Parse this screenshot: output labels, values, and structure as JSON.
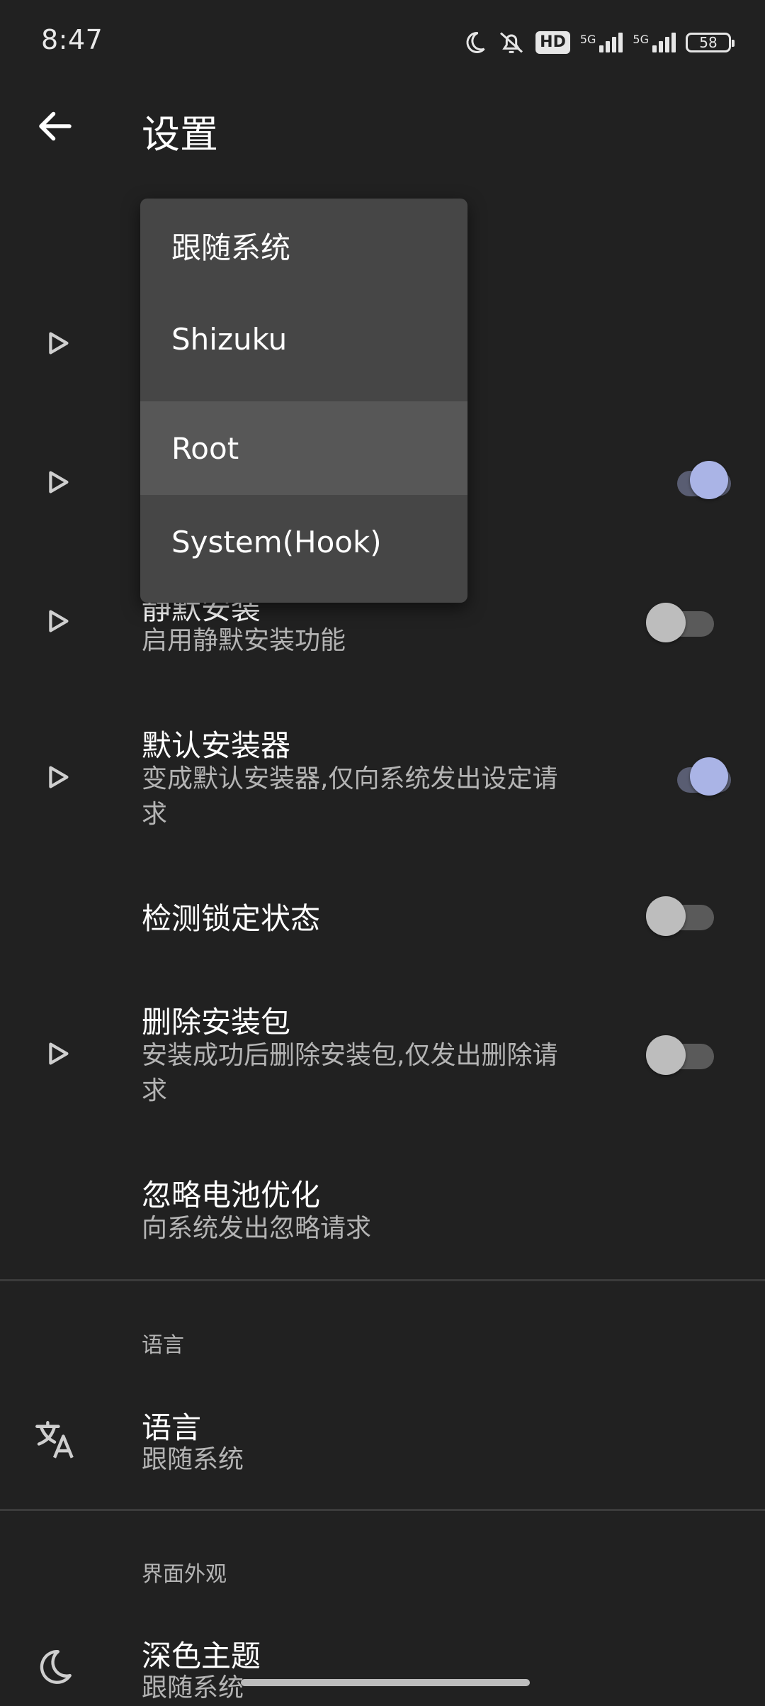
{
  "status_bar": {
    "time": "8:47",
    "hd_badge": "HD",
    "network_1": "5G",
    "network_2": "5G",
    "battery": "58"
  },
  "app_bar": {
    "title": "设置",
    "back_icon": "arrow-back-icon"
  },
  "settings": {
    "silent_install_title": "静默安装",
    "silent_install_sub": "启用静默安装功能",
    "silent_install_on": false,
    "default_installer_title": "默认安装器",
    "default_installer_sub_1": "变成默认安装器,仅向系统发出设定请",
    "default_installer_sub_2": "求",
    "default_installer_on": true,
    "lock_detect_title": "检测锁定状态",
    "lock_detect_on": false,
    "delete_pkg_title": "删除安装包",
    "delete_pkg_sub_1": "安装成功后删除安装包,仅发出删除请",
    "delete_pkg_sub_2": "求",
    "delete_pkg_on": false,
    "battery_title": "忽略电池优化",
    "battery_sub": "向系统发出忽略请求",
    "hidden_switch_on": true
  },
  "language_section": {
    "header": "语言",
    "title": "语言",
    "value": "跟随系统",
    "icon": "translate-icon"
  },
  "appearance_section": {
    "header": "界面外观",
    "title": "深色主题",
    "value": "跟随系统",
    "icon": "moon-icon"
  },
  "dropdown": {
    "options": [
      "跟随系统",
      "Shizuku",
      "Root",
      "System(Hook)"
    ],
    "selected": "Root"
  },
  "colors": {
    "background": "#212121",
    "menu": "#464646",
    "menu_selected": "#575757",
    "accent": "#aab4e6"
  }
}
